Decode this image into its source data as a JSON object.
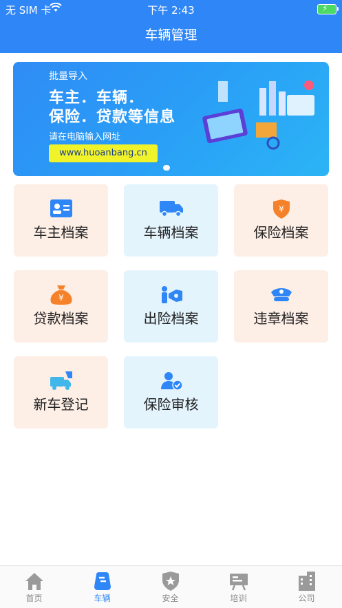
{
  "status_bar": {
    "carrier": "无 SIM 卡",
    "time": "下午 2:43"
  },
  "header": {
    "title": "车辆管理"
  },
  "banner": {
    "line1": "批量导入",
    "line2": "车主．车辆．",
    "line3": "保险．贷款等信息",
    "line4": "请在电脑输入网址",
    "url": "www.huoanbang.cn"
  },
  "tiles": [
    {
      "label": "车主档案",
      "icon": "id-card-icon"
    },
    {
      "label": "车辆档案",
      "icon": "truck-icon"
    },
    {
      "label": "保险档案",
      "icon": "insurance-shield-icon"
    },
    {
      "label": "贷款档案",
      "icon": "money-bag-icon"
    },
    {
      "label": "出险档案",
      "icon": "accident-icon"
    },
    {
      "label": "违章档案",
      "icon": "police-cap-icon"
    },
    {
      "label": "新车登记",
      "icon": "new-car-register-icon"
    },
    {
      "label": "保险审核",
      "icon": "insurance-review-icon"
    }
  ],
  "tabbar": {
    "items": [
      {
        "label": "首页",
        "icon": "home-icon",
        "active": false
      },
      {
        "label": "车辆",
        "icon": "vehicle-icon",
        "active": true
      },
      {
        "label": "安全",
        "icon": "safety-badge-icon",
        "active": false
      },
      {
        "label": "培训",
        "icon": "training-board-icon",
        "active": false
      },
      {
        "label": "公司",
        "icon": "company-building-icon",
        "active": false
      }
    ]
  },
  "colors": {
    "primary": "#2f86f6",
    "tile_peach": "#fdeee6",
    "tile_blue": "#e3f4fd",
    "icon_blue": "#2f86f6",
    "icon_orange": "#f5822a"
  }
}
